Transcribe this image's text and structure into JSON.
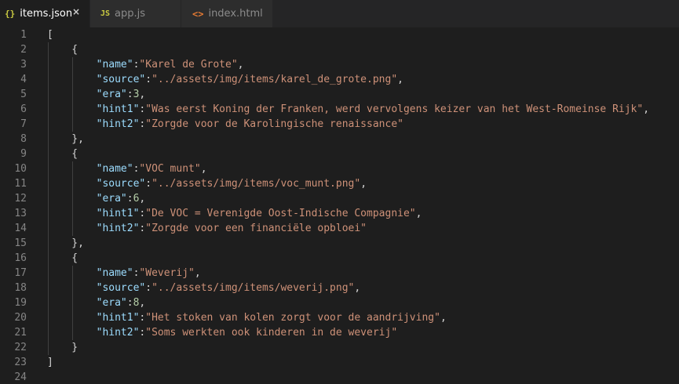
{
  "tabs": [
    {
      "icon": "{}",
      "icon_name": "json-file-icon",
      "label": "items.json",
      "active": true,
      "close": "×"
    },
    {
      "icon": "JS",
      "icon_name": "javascript-file-icon",
      "label": "app.js",
      "active": false
    },
    {
      "icon": "<>",
      "icon_name": "html-file-icon",
      "label": "index.html",
      "active": false
    }
  ],
  "colors": {
    "background": "#1e1e1e",
    "tab_bar": "#252526",
    "inactive_tab": "#2d2d2d",
    "line_number": "#858585",
    "punctuation": "#d4d4d4",
    "property_key": "#9cdcfe",
    "string": "#ce9178",
    "number": "#b5cea8",
    "json_icon": "#cbcb41",
    "html_icon": "#e37933"
  },
  "editor": {
    "lines": [
      {
        "n": "1",
        "tokens": [
          {
            "t": "p",
            "v": "["
          }
        ]
      },
      {
        "n": "2",
        "tokens": [
          {
            "t": "p",
            "v": "    {"
          }
        ]
      },
      {
        "n": "3",
        "tokens": [
          {
            "t": "p",
            "v": "        "
          },
          {
            "t": "k",
            "v": "\"name\""
          },
          {
            "t": "p",
            "v": ":"
          },
          {
            "t": "s",
            "v": "\"Karel de Grote\""
          },
          {
            "t": "p",
            "v": ","
          }
        ]
      },
      {
        "n": "4",
        "tokens": [
          {
            "t": "p",
            "v": "        "
          },
          {
            "t": "k",
            "v": "\"source\""
          },
          {
            "t": "p",
            "v": ":"
          },
          {
            "t": "s",
            "v": "\"../assets/img/items/karel_de_grote.png\""
          },
          {
            "t": "p",
            "v": ","
          }
        ]
      },
      {
        "n": "5",
        "tokens": [
          {
            "t": "p",
            "v": "        "
          },
          {
            "t": "k",
            "v": "\"era\""
          },
          {
            "t": "p",
            "v": ":"
          },
          {
            "t": "n",
            "v": "3"
          },
          {
            "t": "p",
            "v": ","
          }
        ]
      },
      {
        "n": "6",
        "tokens": [
          {
            "t": "p",
            "v": "        "
          },
          {
            "t": "k",
            "v": "\"hint1\""
          },
          {
            "t": "p",
            "v": ":"
          },
          {
            "t": "s",
            "v": "\"Was eerst Koning der Franken, werd vervolgens keizer van het West-Romeinse Rijk\""
          },
          {
            "t": "p",
            "v": ","
          }
        ]
      },
      {
        "n": "7",
        "tokens": [
          {
            "t": "p",
            "v": "        "
          },
          {
            "t": "k",
            "v": "\"hint2\""
          },
          {
            "t": "p",
            "v": ":"
          },
          {
            "t": "s",
            "v": "\"Zorgde voor de Karolingische renaissance\""
          }
        ]
      },
      {
        "n": "8",
        "tokens": [
          {
            "t": "p",
            "v": "    },"
          }
        ]
      },
      {
        "n": "9",
        "tokens": [
          {
            "t": "p",
            "v": "    {"
          }
        ]
      },
      {
        "n": "10",
        "tokens": [
          {
            "t": "p",
            "v": "        "
          },
          {
            "t": "k",
            "v": "\"name\""
          },
          {
            "t": "p",
            "v": ":"
          },
          {
            "t": "s",
            "v": "\"VOC munt\""
          },
          {
            "t": "p",
            "v": ","
          }
        ]
      },
      {
        "n": "11",
        "tokens": [
          {
            "t": "p",
            "v": "        "
          },
          {
            "t": "k",
            "v": "\"source\""
          },
          {
            "t": "p",
            "v": ":"
          },
          {
            "t": "s",
            "v": "\"../assets/img/items/voc_munt.png\""
          },
          {
            "t": "p",
            "v": ","
          }
        ]
      },
      {
        "n": "12",
        "tokens": [
          {
            "t": "p",
            "v": "        "
          },
          {
            "t": "k",
            "v": "\"era\""
          },
          {
            "t": "p",
            "v": ":"
          },
          {
            "t": "n",
            "v": "6"
          },
          {
            "t": "p",
            "v": ","
          }
        ]
      },
      {
        "n": "13",
        "tokens": [
          {
            "t": "p",
            "v": "        "
          },
          {
            "t": "k",
            "v": "\"hint1\""
          },
          {
            "t": "p",
            "v": ":"
          },
          {
            "t": "s",
            "v": "\"De VOC = Verenigde Oost-Indische Compagnie\""
          },
          {
            "t": "p",
            "v": ","
          }
        ]
      },
      {
        "n": "14",
        "tokens": [
          {
            "t": "p",
            "v": "        "
          },
          {
            "t": "k",
            "v": "\"hint2\""
          },
          {
            "t": "p",
            "v": ":"
          },
          {
            "t": "s",
            "v": "\"Zorgde voor een financiële opbloei\""
          }
        ]
      },
      {
        "n": "15",
        "tokens": [
          {
            "t": "p",
            "v": "    },"
          }
        ]
      },
      {
        "n": "16",
        "tokens": [
          {
            "t": "p",
            "v": "    {"
          }
        ]
      },
      {
        "n": "17",
        "tokens": [
          {
            "t": "p",
            "v": "        "
          },
          {
            "t": "k",
            "v": "\"name\""
          },
          {
            "t": "p",
            "v": ":"
          },
          {
            "t": "s",
            "v": "\"Weverij\""
          },
          {
            "t": "p",
            "v": ","
          }
        ]
      },
      {
        "n": "18",
        "tokens": [
          {
            "t": "p",
            "v": "        "
          },
          {
            "t": "k",
            "v": "\"source\""
          },
          {
            "t": "p",
            "v": ":"
          },
          {
            "t": "s",
            "v": "\"../assets/img/items/weverij.png\""
          },
          {
            "t": "p",
            "v": ","
          }
        ]
      },
      {
        "n": "19",
        "tokens": [
          {
            "t": "p",
            "v": "        "
          },
          {
            "t": "k",
            "v": "\"era\""
          },
          {
            "t": "p",
            "v": ":"
          },
          {
            "t": "n",
            "v": "8"
          },
          {
            "t": "p",
            "v": ","
          }
        ]
      },
      {
        "n": "20",
        "tokens": [
          {
            "t": "p",
            "v": "        "
          },
          {
            "t": "k",
            "v": "\"hint1\""
          },
          {
            "t": "p",
            "v": ":"
          },
          {
            "t": "s",
            "v": "\"Het stoken van kolen zorgt voor de aandrijving\""
          },
          {
            "t": "p",
            "v": ","
          }
        ]
      },
      {
        "n": "21",
        "tokens": [
          {
            "t": "p",
            "v": "        "
          },
          {
            "t": "k",
            "v": "\"hint2\""
          },
          {
            "t": "p",
            "v": ":"
          },
          {
            "t": "s",
            "v": "\"Soms werkten ook kinderen in de weverij\""
          }
        ]
      },
      {
        "n": "22",
        "tokens": [
          {
            "t": "p",
            "v": "    }"
          }
        ]
      },
      {
        "n": "23",
        "tokens": [
          {
            "t": "p",
            "v": "]"
          }
        ]
      },
      {
        "n": "24",
        "tokens": []
      }
    ]
  }
}
